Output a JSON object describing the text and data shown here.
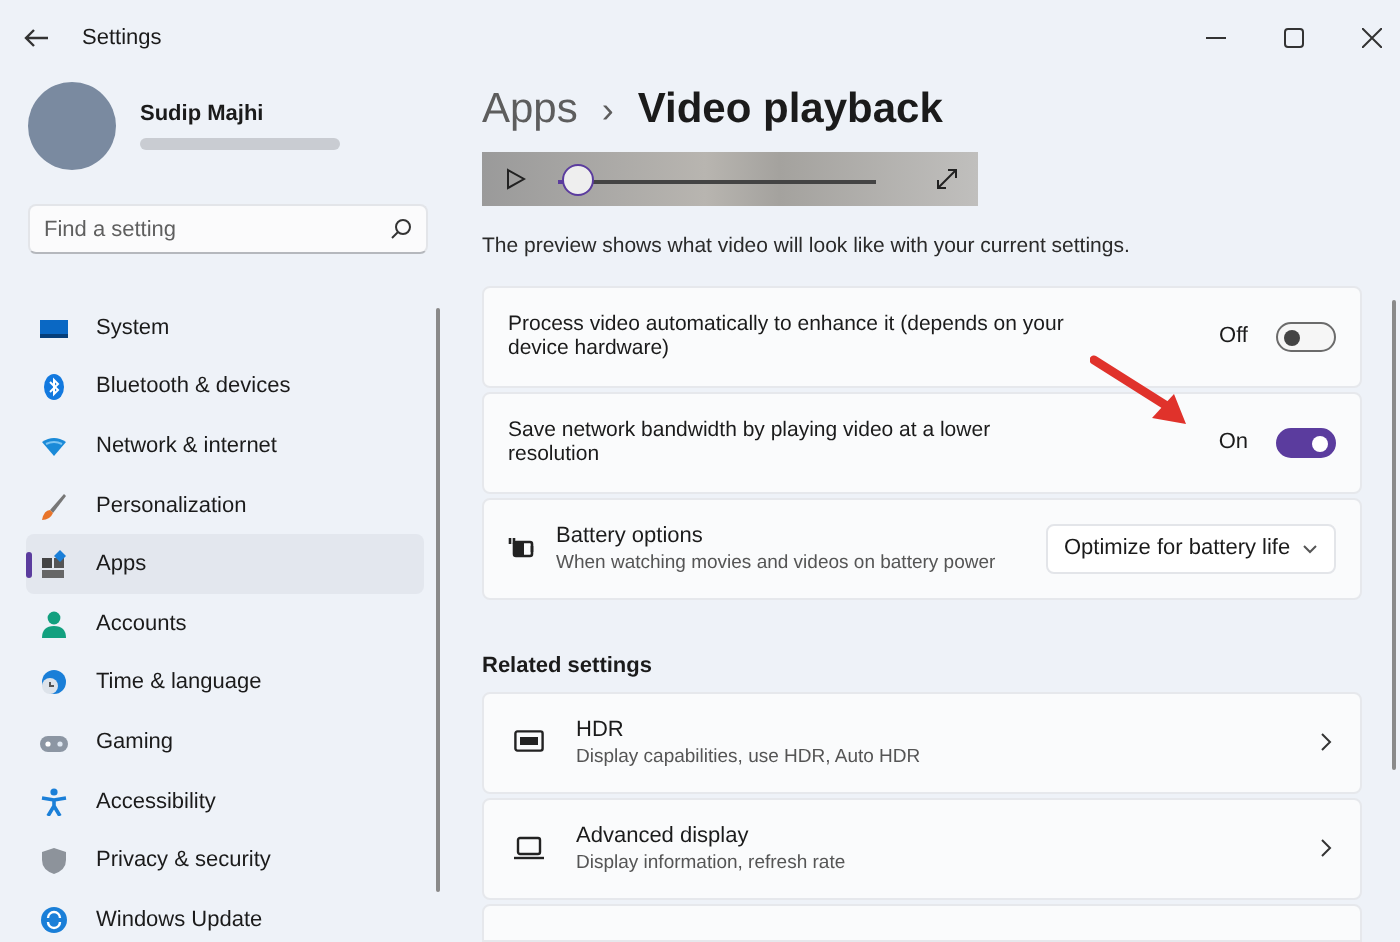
{
  "window": {
    "title": "Settings"
  },
  "profile": {
    "name": "Sudip Majhi"
  },
  "search": {
    "placeholder": "Find a setting"
  },
  "sidebar": {
    "items": [
      {
        "label": "System",
        "selected": false
      },
      {
        "label": "Bluetooth & devices",
        "selected": false
      },
      {
        "label": "Network & internet",
        "selected": false
      },
      {
        "label": "Personalization",
        "selected": false
      },
      {
        "label": "Apps",
        "selected": true
      },
      {
        "label": "Accounts",
        "selected": false
      },
      {
        "label": "Time & language",
        "selected": false
      },
      {
        "label": "Gaming",
        "selected": false
      },
      {
        "label": "Accessibility",
        "selected": false
      },
      {
        "label": "Privacy & security",
        "selected": false
      },
      {
        "label": "Windows Update",
        "selected": false
      }
    ]
  },
  "breadcrumb": {
    "parent": "Apps",
    "separator": "›",
    "current": "Video playback"
  },
  "video_preview": {
    "level": 0.06
  },
  "description": "The preview shows what video will look like with your current settings.",
  "settings": [
    {
      "kind": "toggle",
      "label": "Process video automatically to enhance it (depends on your device hardware)",
      "state_label": "Off",
      "on": false
    },
    {
      "kind": "toggle",
      "label": "Save network bandwidth by playing video at a lower resolution",
      "state_label": "On",
      "on": true
    },
    {
      "kind": "dropdown",
      "label": "Battery options",
      "subtitle": "When watching movies and videos on battery power",
      "value": "Optimize for battery life"
    }
  ],
  "related_settings": {
    "heading": "Related settings",
    "items": [
      {
        "title": "HDR",
        "subtitle": "Display capabilities, use HDR, Auto HDR"
      },
      {
        "title": "Advanced display",
        "subtitle": "Display information, refresh rate"
      }
    ]
  }
}
